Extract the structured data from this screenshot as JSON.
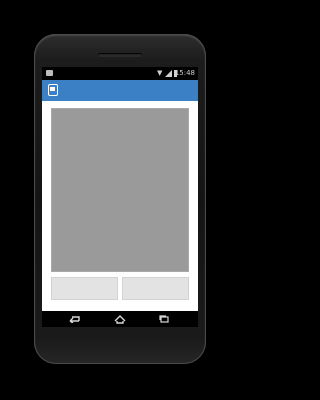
{
  "status_bar": {
    "time": "15:48",
    "icons": [
      "notification-icon",
      "wifi-icon",
      "signal-icon",
      "battery-icon"
    ]
  },
  "action_bar": {
    "color": "#3b7fc4",
    "icon": "app-icon"
  },
  "content": {
    "preview_color": "#9a9a9a",
    "buttons": [
      {
        "label": ""
      },
      {
        "label": ""
      }
    ]
  },
  "nav_bar": {
    "icons": [
      "back-icon",
      "home-icon",
      "recent-apps-icon"
    ]
  }
}
